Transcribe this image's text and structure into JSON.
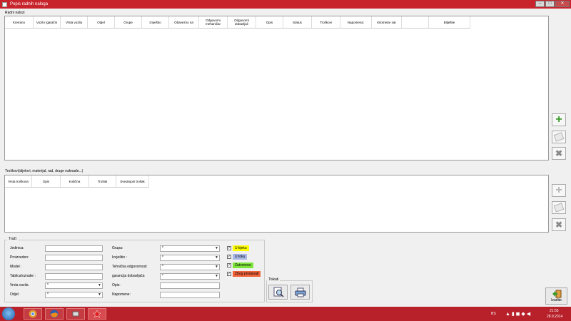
{
  "window": {
    "title": "Popis radnih naloga",
    "min": "–",
    "max": "□",
    "close": "✕"
  },
  "orders": {
    "label": "Radni nalozi",
    "columns": [
      "Kreirano",
      "Vozilo Igaražni",
      "Vrsta vozila",
      "Odjel",
      "Grupe",
      "Izvještio",
      "Obavezno na",
      "Odgovorni mehaničar",
      "Odgovorni dobavljač",
      "Opis",
      "Status",
      "Troškovi",
      "Napomena:",
      "Kilometar sat",
      "",
      "Bilješke"
    ]
  },
  "costs": {
    "label": "Troškovi(dijelovi, materijal, rad, druge naknade...)",
    "columns": [
      "Vrsta troškova",
      "Opis",
      "Količina",
      "Trošak",
      "Sveukupni trošak"
    ]
  },
  "search": {
    "legend": "Traži",
    "jedinica_label": "Jedinica:",
    "proizveden_label": "Proizveden:",
    "model_label": "Model :",
    "tablica_label": "Tablica/oznake :",
    "vrsta_label": "Vrsta vozila",
    "odjel_label": "Odjel:",
    "vrsta_value": "*",
    "odjel_value": "*",
    "grupa_label": "Grupa:",
    "izvjestio_label": "Izvještio :",
    "tehnicka_label": "Tehnička odgovornost",
    "garancija_label": "garancija dobavljača",
    "opis_label": "Opis:",
    "napomene_label": "Napomene:",
    "grupa_value": "*",
    "izvjestio_value": "*",
    "tehnicka_value": "*",
    "garancija_value": "*"
  },
  "status_filters": [
    {
      "label": "U tijeku",
      "color": "#ffff00",
      "checked": true
    },
    {
      "label": "U toku",
      "color": "#a9b7e6",
      "checked": true
    },
    {
      "label": "Zatvoreno",
      "color": "#7de33a",
      "checked": true
    },
    {
      "label": "Zbog prodavati",
      "color": "#f0623a",
      "checked": true
    }
  ],
  "print": {
    "legend": "Tiskati"
  },
  "exit": {
    "label": "Izađite"
  },
  "taskbar": {
    "lang": "BS",
    "time": "21:55",
    "date": "28.9.2014"
  }
}
